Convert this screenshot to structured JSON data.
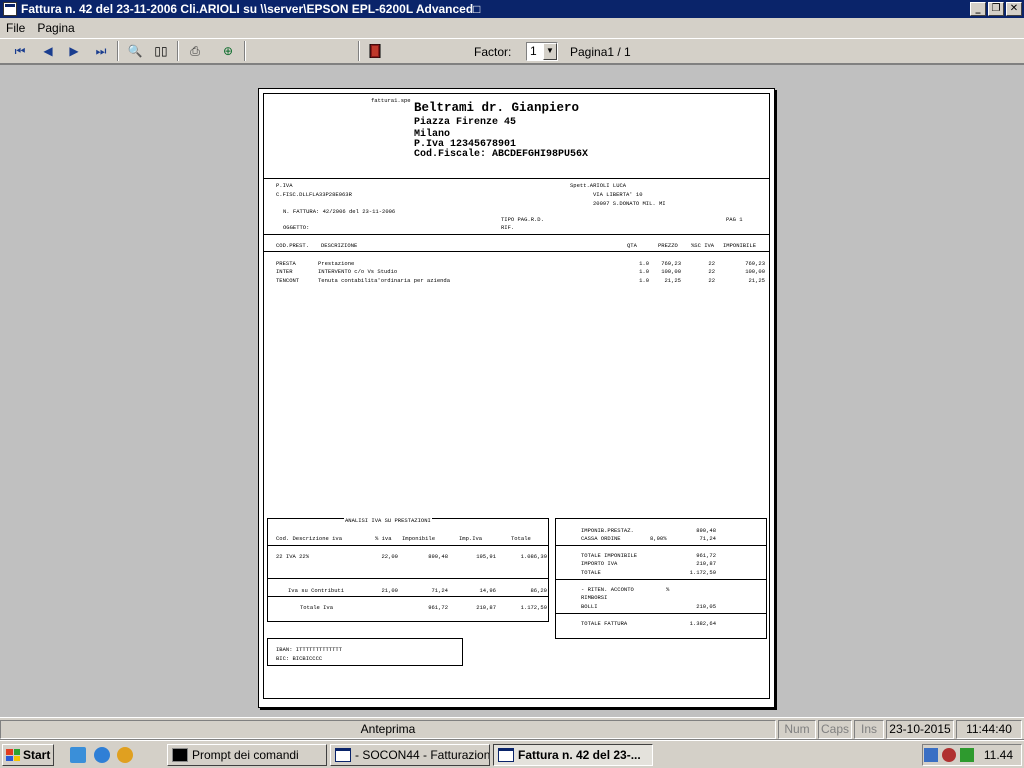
{
  "window": {
    "title": "Fattura n.  42 del 23-11-2006 Cli.ARIOLI su \\\\server\\EPSON EPL-6200L Advanced□",
    "buttons": [
      "minimize-icon",
      "restore-icon",
      "close-icon"
    ]
  },
  "menu": {
    "items": [
      "File",
      "Pagina"
    ]
  },
  "toolbar": {
    "icons": [
      "first-page-icon",
      "prev-page-icon",
      "next-page-icon",
      "last-page-icon",
      "zoom-icon",
      "two-pages-icon",
      "printer-icon",
      "export-icon",
      "exit-door-icon"
    ],
    "factor_label": "Factor:",
    "factor_value": "1",
    "page_label": "Pagina1 / 1"
  },
  "invoice": {
    "file_tag": "fattura1.spe",
    "issuer": {
      "name": "Beltrami dr. Gianpiero",
      "address": "Piazza Firenze 45",
      "city": "Milano",
      "piva": "P.Iva 12345678901",
      "cf": "Cod.Fiscale: ABCDEFGHI98PU56X"
    },
    "client_block": {
      "piva_label": "P.IVA",
      "cf_line": "C.FISC.DLLFLA33P28E063R",
      "number_line": "N. FATTURA:   42/2006 del 23-11-2006",
      "oggetto_label": "OGGETTO:",
      "recipient": [
        "Spett.ARIOLI LUCA",
        "VIA LIBERTA' 10",
        "20097 S.DONATO MIL. MI"
      ],
      "tipo_pag": "TIPO PAG.R.D.",
      "rif": "RIF.",
      "pag": "PAG   1"
    },
    "columns": [
      "COD.PREST.",
      "DESCRIZIONE",
      "QTA",
      "PREZZO",
      "%SC IVA",
      "IMPONIBILE"
    ],
    "rows": [
      {
        "code": "PRESTA",
        "desc": "Prestazione",
        "qta": "1.0",
        "price": "769,23",
        "iva": "22",
        "imp": "769,23"
      },
      {
        "code": "INTER",
        "desc": "INTERVENTO c/o Vs Studio",
        "qta": "1.0",
        "price": "100,00",
        "iva": "22",
        "imp": "100,00"
      },
      {
        "code": "TENCONT",
        "desc": "Tenuta contabilita'ordinaria per azienda",
        "qta": "1.0",
        "price": "21,25",
        "iva": "22",
        "imp": "21,25"
      }
    ],
    "iva_analysis": {
      "title": "ANALISI IVA SU PRESTAZIONI",
      "headers": [
        "Cod. Descrizione iva",
        "% iva",
        "Imponibile",
        "Imp.Iva",
        "Totale"
      ],
      "row": {
        "cod": "22  IVA 22%",
        "pct": "22,00",
        "imp": "890,48",
        "iva": "195,91",
        "tot": "1.086,39"
      },
      "contrib": {
        "label": "Iva su Contributi",
        "pct": "21,00",
        "imp": "71,24",
        "iva": "14,96",
        "tot": "86,20"
      },
      "total": {
        "label": "Totale Iva",
        "imp": "961,72",
        "iva": "210,87",
        "tot": "1.172,59"
      }
    },
    "totals": {
      "imponib_label": "IMPONIB.PRESTAZ.",
      "imponib": "890,48",
      "cassa_label": "CASSA ORDINE",
      "cassa_pct": "8,00%",
      "cassa": "71,24",
      "tot_imp_label": "TOTALE IMPONIBILE",
      "tot_imp": "961,72",
      "iva_label": "IMPORTO IVA",
      "iva": "210,87",
      "totale_label": "TOTALE",
      "totale": "1.172,59",
      "ritenuta_label": "- RITEN. ACCONTO",
      "ritenuta_pct": "%",
      "rimborsi_label": "RIMBORSI",
      "bolli_label": "BOLLI",
      "bolli": "210,05",
      "fattura_label": "TOTALE FATTURA",
      "fattura": "1.382,64"
    },
    "bank": {
      "iban": "IBAN: ITTTTTTTTTTTTT",
      "bic": "BIC: BICBICCCC"
    }
  },
  "statusbar": {
    "mode": "Anteprima",
    "num": "Num",
    "caps": "Caps",
    "ins": "Ins",
    "date": "23-10-2015",
    "time": "11:44:40"
  },
  "taskbar": {
    "start": "Start",
    "tasks": [
      "Prompt dei comandi",
      "- SOCON44 - Fatturazion...",
      "Fattura n.  42 del 23-..."
    ],
    "clock": "11.44"
  }
}
